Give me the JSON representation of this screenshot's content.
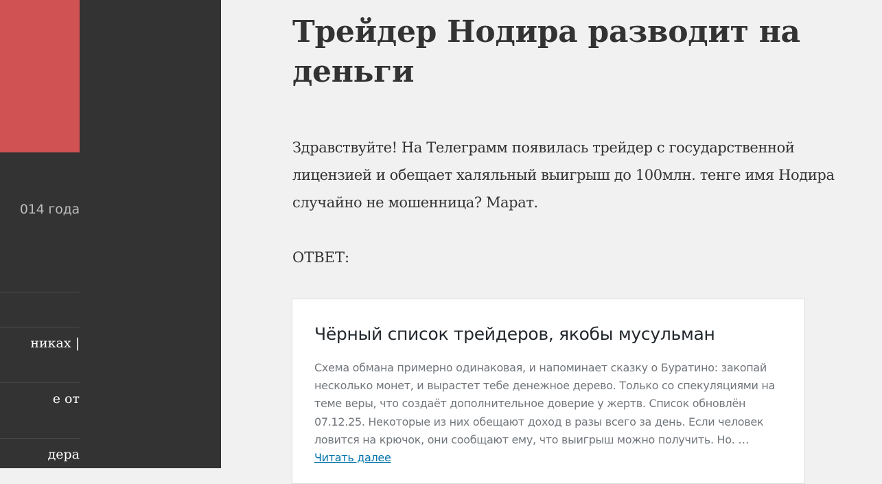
{
  "sidebar": {
    "header_color": "#d05253",
    "date_text": "014 года",
    "links": [
      {
        "label": "никах |"
      },
      {
        "label": "е от"
      },
      {
        "label": "дера"
      }
    ]
  },
  "post": {
    "title": "Трейдер Нодира разводит на деньги",
    "paragraph": "Здравствуйте! На Телеграмм появилась трейдер с государственной лицензией и обещает халяльный выигрыш до 100млн. тенге имя Нодира случайно не мошенница? Марат.",
    "answer_label": "ОТВЕТ:"
  },
  "embed": {
    "title": "Чёрный список трейдеров, якобы мусульман",
    "excerpt": "Схема обмана примерно одинаковая, и напоминает сказку о Буратино: закопай несколько монет, и вырастет тебе денежное дерево. Только со спекуляциями на теме веры, что создаёт дополнительное доверие у жертв. Список обновлён 07.12.25. Некоторые из них обещают доход в разы всего за день. Если человек ловится на крючок, они сообщают ему, что выигрыш можно получить. Но. … ",
    "read_more": "Читать далее",
    "link_color": "#0073aa"
  }
}
